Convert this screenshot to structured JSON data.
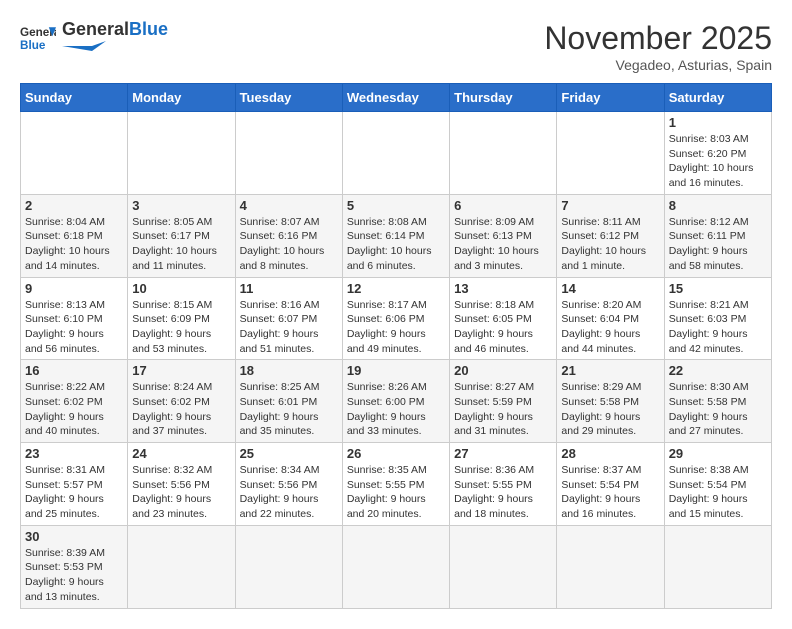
{
  "header": {
    "logo_general": "General",
    "logo_blue": "Blue",
    "month": "November 2025",
    "location": "Vegadeo, Asturias, Spain"
  },
  "weekdays": [
    "Sunday",
    "Monday",
    "Tuesday",
    "Wednesday",
    "Thursday",
    "Friday",
    "Saturday"
  ],
  "weeks": [
    [
      {
        "day": "",
        "info": ""
      },
      {
        "day": "",
        "info": ""
      },
      {
        "day": "",
        "info": ""
      },
      {
        "day": "",
        "info": ""
      },
      {
        "day": "",
        "info": ""
      },
      {
        "day": "",
        "info": ""
      },
      {
        "day": "1",
        "info": "Sunrise: 8:03 AM\nSunset: 6:20 PM\nDaylight: 10 hours and 16 minutes."
      }
    ],
    [
      {
        "day": "2",
        "info": "Sunrise: 8:04 AM\nSunset: 6:18 PM\nDaylight: 10 hours and 14 minutes."
      },
      {
        "day": "3",
        "info": "Sunrise: 8:05 AM\nSunset: 6:17 PM\nDaylight: 10 hours and 11 minutes."
      },
      {
        "day": "4",
        "info": "Sunrise: 8:07 AM\nSunset: 6:16 PM\nDaylight: 10 hours and 8 minutes."
      },
      {
        "day": "5",
        "info": "Sunrise: 8:08 AM\nSunset: 6:14 PM\nDaylight: 10 hours and 6 minutes."
      },
      {
        "day": "6",
        "info": "Sunrise: 8:09 AM\nSunset: 6:13 PM\nDaylight: 10 hours and 3 minutes."
      },
      {
        "day": "7",
        "info": "Sunrise: 8:11 AM\nSunset: 6:12 PM\nDaylight: 10 hours and 1 minute."
      },
      {
        "day": "8",
        "info": "Sunrise: 8:12 AM\nSunset: 6:11 PM\nDaylight: 9 hours and 58 minutes."
      }
    ],
    [
      {
        "day": "9",
        "info": "Sunrise: 8:13 AM\nSunset: 6:10 PM\nDaylight: 9 hours and 56 minutes."
      },
      {
        "day": "10",
        "info": "Sunrise: 8:15 AM\nSunset: 6:09 PM\nDaylight: 9 hours and 53 minutes."
      },
      {
        "day": "11",
        "info": "Sunrise: 8:16 AM\nSunset: 6:07 PM\nDaylight: 9 hours and 51 minutes."
      },
      {
        "day": "12",
        "info": "Sunrise: 8:17 AM\nSunset: 6:06 PM\nDaylight: 9 hours and 49 minutes."
      },
      {
        "day": "13",
        "info": "Sunrise: 8:18 AM\nSunset: 6:05 PM\nDaylight: 9 hours and 46 minutes."
      },
      {
        "day": "14",
        "info": "Sunrise: 8:20 AM\nSunset: 6:04 PM\nDaylight: 9 hours and 44 minutes."
      },
      {
        "day": "15",
        "info": "Sunrise: 8:21 AM\nSunset: 6:03 PM\nDaylight: 9 hours and 42 minutes."
      }
    ],
    [
      {
        "day": "16",
        "info": "Sunrise: 8:22 AM\nSunset: 6:02 PM\nDaylight: 9 hours and 40 minutes."
      },
      {
        "day": "17",
        "info": "Sunrise: 8:24 AM\nSunset: 6:02 PM\nDaylight: 9 hours and 37 minutes."
      },
      {
        "day": "18",
        "info": "Sunrise: 8:25 AM\nSunset: 6:01 PM\nDaylight: 9 hours and 35 minutes."
      },
      {
        "day": "19",
        "info": "Sunrise: 8:26 AM\nSunset: 6:00 PM\nDaylight: 9 hours and 33 minutes."
      },
      {
        "day": "20",
        "info": "Sunrise: 8:27 AM\nSunset: 5:59 PM\nDaylight: 9 hours and 31 minutes."
      },
      {
        "day": "21",
        "info": "Sunrise: 8:29 AM\nSunset: 5:58 PM\nDaylight: 9 hours and 29 minutes."
      },
      {
        "day": "22",
        "info": "Sunrise: 8:30 AM\nSunset: 5:58 PM\nDaylight: 9 hours and 27 minutes."
      }
    ],
    [
      {
        "day": "23",
        "info": "Sunrise: 8:31 AM\nSunset: 5:57 PM\nDaylight: 9 hours and 25 minutes."
      },
      {
        "day": "24",
        "info": "Sunrise: 8:32 AM\nSunset: 5:56 PM\nDaylight: 9 hours and 23 minutes."
      },
      {
        "day": "25",
        "info": "Sunrise: 8:34 AM\nSunset: 5:56 PM\nDaylight: 9 hours and 22 minutes."
      },
      {
        "day": "26",
        "info": "Sunrise: 8:35 AM\nSunset: 5:55 PM\nDaylight: 9 hours and 20 minutes."
      },
      {
        "day": "27",
        "info": "Sunrise: 8:36 AM\nSunset: 5:55 PM\nDaylight: 9 hours and 18 minutes."
      },
      {
        "day": "28",
        "info": "Sunrise: 8:37 AM\nSunset: 5:54 PM\nDaylight: 9 hours and 16 minutes."
      },
      {
        "day": "29",
        "info": "Sunrise: 8:38 AM\nSunset: 5:54 PM\nDaylight: 9 hours and 15 minutes."
      }
    ],
    [
      {
        "day": "30",
        "info": "Sunrise: 8:39 AM\nSunset: 5:53 PM\nDaylight: 9 hours and 13 minutes."
      },
      {
        "day": "",
        "info": ""
      },
      {
        "day": "",
        "info": ""
      },
      {
        "day": "",
        "info": ""
      },
      {
        "day": "",
        "info": ""
      },
      {
        "day": "",
        "info": ""
      },
      {
        "day": "",
        "info": ""
      }
    ]
  ]
}
